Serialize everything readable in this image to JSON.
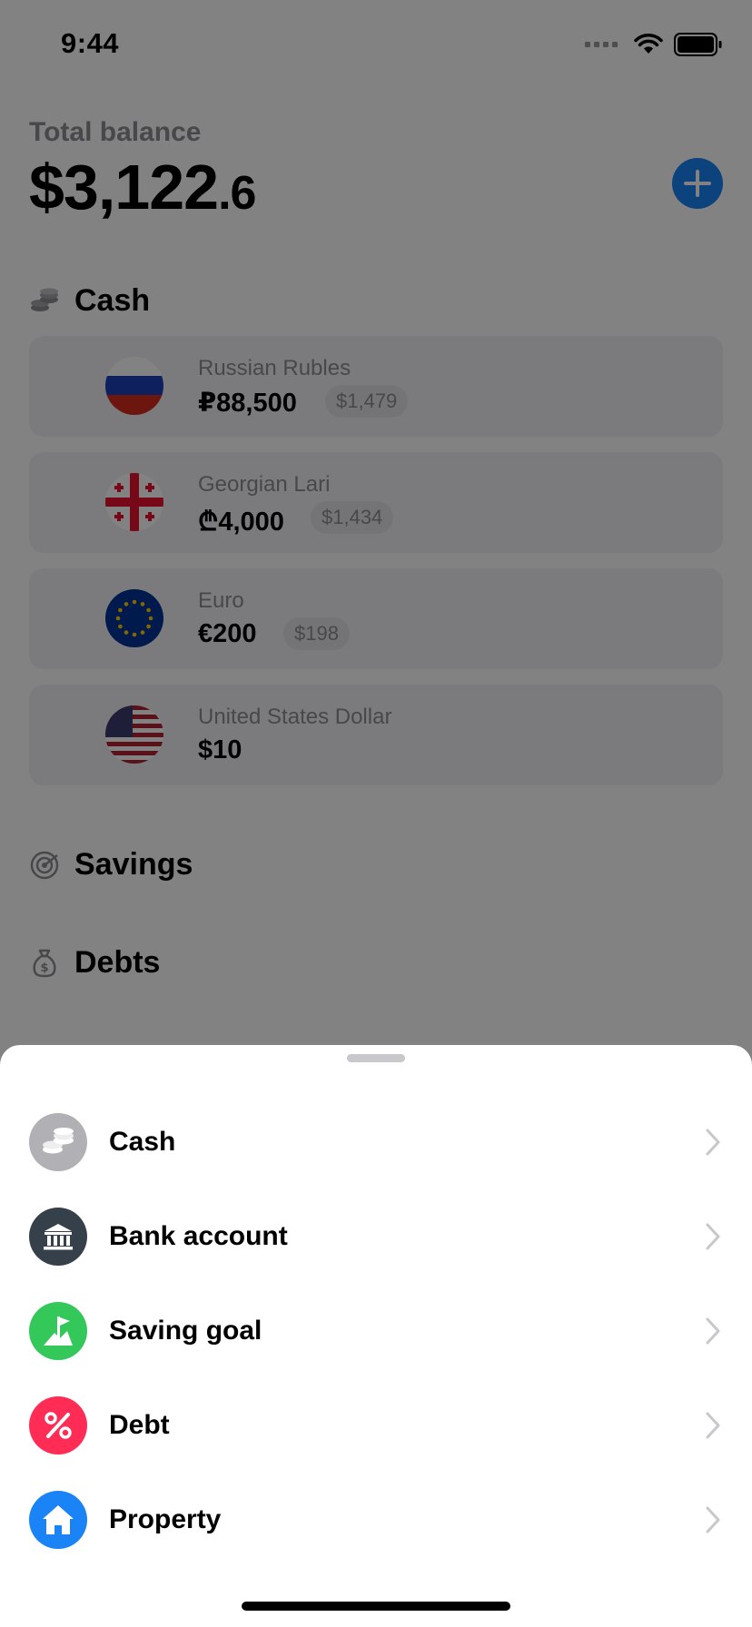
{
  "status_bar": {
    "time": "9:44"
  },
  "header": {
    "total_label": "Total balance",
    "total_whole": "$3,122",
    "total_fraction": ".6"
  },
  "sections": {
    "cash_title": "Cash",
    "savings_title": "Savings",
    "debts_title": "Debts"
  },
  "accounts": [
    {
      "name": "Russian Rubles",
      "amount": "₽88,500",
      "converted": "$1,479"
    },
    {
      "name": "Georgian Lari",
      "amount": "₾4,000",
      "converted": "$1,434"
    },
    {
      "name": "Euro",
      "amount": "€200",
      "converted": "$198"
    },
    {
      "name": "United States Dollar",
      "amount": "$10"
    }
  ],
  "sheet": {
    "options": [
      {
        "label": "Cash",
        "icon": "coins-icon",
        "color": "#b0b0b5"
      },
      {
        "label": "Bank account",
        "icon": "bank-icon",
        "color": "#35404a"
      },
      {
        "label": "Saving goal",
        "icon": "flag-goal-icon",
        "color": "#34c759"
      },
      {
        "label": "Debt",
        "icon": "percent-icon",
        "color": "#ff2d55"
      },
      {
        "label": "Property",
        "icon": "house-icon",
        "color": "#1a83f6"
      }
    ]
  },
  "colors": {
    "accent": "#1a83f6",
    "overlay": "rgba(0,0,0,0.49)"
  }
}
